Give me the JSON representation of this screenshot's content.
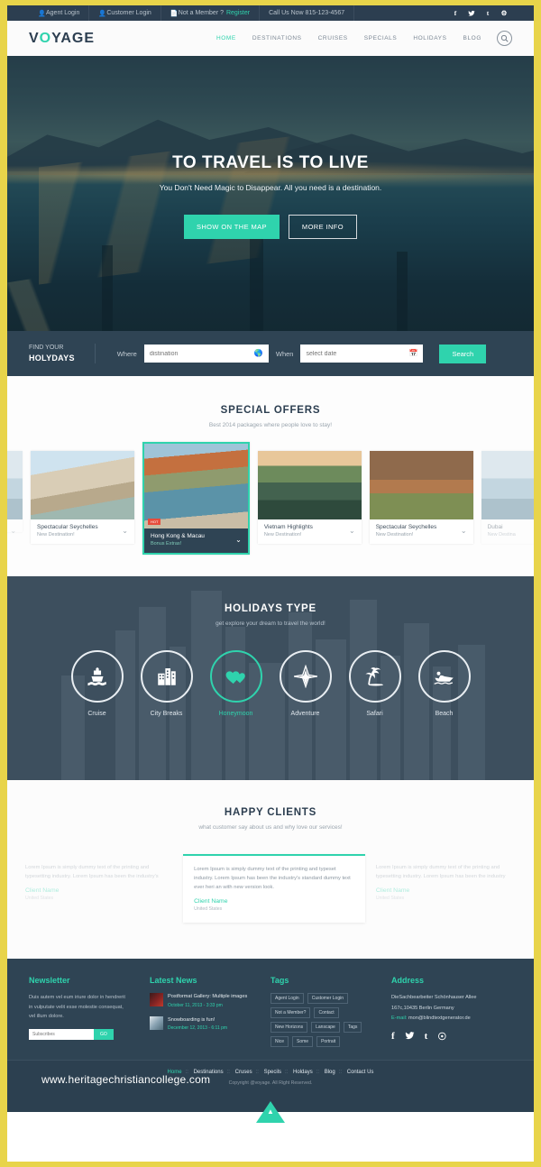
{
  "topbar": {
    "items": [
      {
        "icon": "user-icon",
        "label": "Agent Login"
      },
      {
        "icon": "user-icon",
        "label": "Customer Login"
      },
      {
        "icon": "file-icon",
        "label": "Not a Member ?",
        "link": "Register"
      }
    ],
    "phone": "Call Us Now  815-123-4567",
    "socials": [
      "f",
      "t",
      "t",
      "g"
    ]
  },
  "header": {
    "logo_pre": "V",
    "logo_mid": "O",
    "logo_post": "YAGE",
    "nav": [
      {
        "label": "HOME",
        "active": true
      },
      {
        "label": "DESTINATIONS",
        "active": false
      },
      {
        "label": "CRUISES",
        "active": false
      },
      {
        "label": "SPECIALS",
        "active": false
      },
      {
        "label": "HOLIDAYS",
        "active": false
      },
      {
        "label": "BLOG",
        "active": false
      }
    ],
    "search_icon": "search-icon"
  },
  "hero": {
    "title": "TO TRAVEL IS TO LIVE",
    "subtitle": "You Don't Need Magic to Disappear. All you need is a destination.",
    "primary_button": "SHOW ON THE MAP",
    "secondary_button": "MORE INFO"
  },
  "findbar": {
    "label_top": "FIND YOUR",
    "label_bottom": "HOLYDAYS",
    "where_label": "Where",
    "where_placeholder": "distination",
    "when_label": "When",
    "when_placeholder": "select date",
    "search_button": "Search"
  },
  "offers": {
    "title": "SPECIAL OFFERS",
    "subtitle": "Best 2014 packages where people love to stay!",
    "cards": [
      {
        "title": "",
        "subtitle": "",
        "image": "img-dubai",
        "state": "edge-left"
      },
      {
        "title": "Spectacular Seychelles",
        "subtitle": "New Destination!",
        "image": "img-seychelles",
        "state": "normal"
      },
      {
        "title": "Hong Kong & Macau",
        "subtitle": "Bonus Extras!",
        "image": "img-hk",
        "state": "active",
        "badge": "HOT"
      },
      {
        "title": "Vietnam Highlights",
        "subtitle": "New Destination!",
        "image": "img-vietnam",
        "state": "normal"
      },
      {
        "title": "Spectacular Seychelles",
        "subtitle": "New Destination!",
        "image": "img-canyon",
        "state": "normal"
      },
      {
        "title": "Dubai",
        "subtitle": "New Destina",
        "image": "img-dubai",
        "state": "edge-right"
      }
    ]
  },
  "holidays": {
    "title": "HOLIDAYS TYPE",
    "subtitle": "get explore your dream to travel the world!",
    "types": [
      {
        "label": "Cruise",
        "icon": "ship-icon",
        "active": false
      },
      {
        "label": "City Breaks",
        "icon": "buildings-icon",
        "active": false
      },
      {
        "label": "Honeymoon",
        "icon": "hearts-icon",
        "active": true
      },
      {
        "label": "Adventure",
        "icon": "compass-icon",
        "active": false
      },
      {
        "label": "Safari",
        "icon": "palm-tree-icon",
        "active": false
      },
      {
        "label": "Beach",
        "icon": "speedboat-icon",
        "active": false
      }
    ]
  },
  "clients": {
    "title": "HAPPY CLIENTS",
    "subtitle": "what customer say about us and why love our services!",
    "testimonials": [
      {
        "text": "Lorem Ipsum is simply dummy text of the printing and typesetting industry. Lorem Ipsum has been the industry's",
        "name": "Client Name",
        "country": "United States",
        "state": "side"
      },
      {
        "text": "Lorem Ipsum is simply dummy text of the printing and typeset industry. Lorem Ipsum has been the industry's standard dummy text ever heri an with new version look.",
        "name": "Client Name",
        "country": "United States",
        "state": "active"
      },
      {
        "text": "Lorem Ipsum is simply dummy text of the printing and typesetting industry. Lorem Ipsum has been the industry",
        "name": "Client Name",
        "country": "United States",
        "state": "side"
      }
    ]
  },
  "footer": {
    "newsletter": {
      "title": "Newsletter",
      "text": "Duis autem vel eum iriure dolor in hendrerit in vulputate velit esse molestie consequat, vel illum dolore.",
      "input_placeholder": "Subscribes",
      "button": "GO"
    },
    "news": {
      "title": "Latest News",
      "items": [
        {
          "title": "Postformat Gallery: Multiple images",
          "date": "October 11, 2013 - 3:33 pm"
        },
        {
          "title": "Snowboarding is fun!",
          "date": "December 12, 2013 - 6:11 pm"
        }
      ]
    },
    "tags": {
      "title": "Tags",
      "items": [
        "Agent Login",
        "Customer Login",
        "Not a Member?",
        "Contact",
        "New Horizons",
        "Lanscape",
        "Tags",
        "Nice",
        "Some",
        "Portrait"
      ]
    },
    "address": {
      "title": "Address",
      "line1": "DieSachbearbeiter Schönhauser Allee",
      "line2": "167c,10435 Berlin Germany",
      "email_label": "E-mail:",
      "email": "mon@blindtextgenerator.de",
      "socials": [
        "f",
        "t",
        "t",
        "p"
      ]
    }
  },
  "bottom": {
    "nav": [
      {
        "label": "Home",
        "active": true
      },
      {
        "label": "Destinations",
        "active": false
      },
      {
        "label": "Cruses",
        "active": false
      },
      {
        "label": "Specils",
        "active": false
      },
      {
        "label": "Holdays",
        "active": false
      },
      {
        "label": "Blog",
        "active": false
      },
      {
        "label": "Contact Us",
        "active": false
      }
    ],
    "copyright": "Copyright @voyage. All Right Reserved.",
    "watermark": "www.heritagechristiancollege.com"
  }
}
